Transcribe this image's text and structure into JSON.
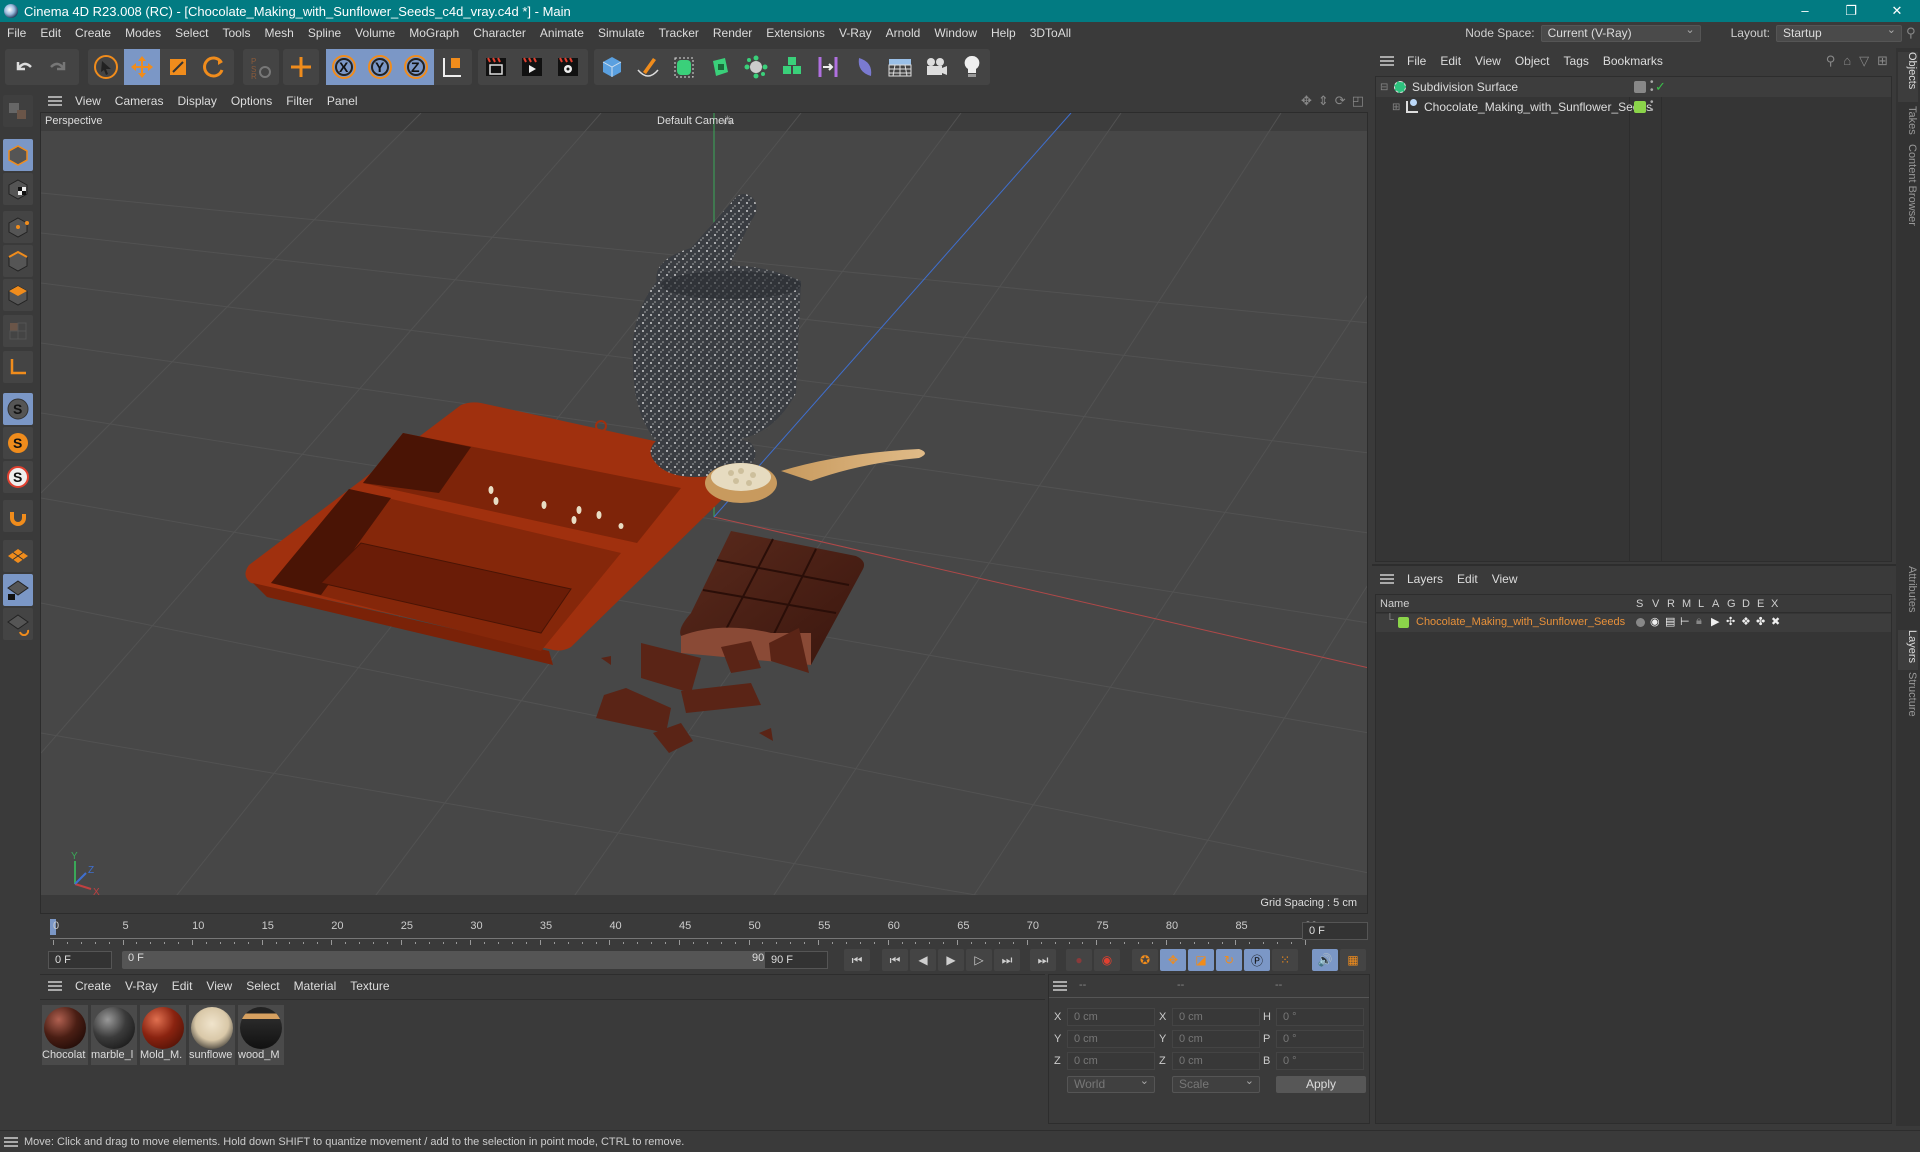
{
  "window": {
    "title": "Cinema 4D R23.008 (RC) - [Chocolate_Making_with_Sunflower_Seeds_c4d_vray.c4d *] - Main",
    "controls": [
      "–",
      "❐",
      "✕"
    ]
  },
  "menubar": {
    "items": [
      "File",
      "Edit",
      "Create",
      "Modes",
      "Select",
      "Tools",
      "Mesh",
      "Spline",
      "Volume",
      "MoGraph",
      "Character",
      "Animate",
      "Simulate",
      "Tracker",
      "Render",
      "Extensions",
      "V-Ray",
      "Arnold",
      "Window",
      "Help",
      "3DToAll"
    ],
    "node_space_label": "Node Space:",
    "node_space_value": "Current (V-Ray)",
    "layout_label": "Layout:",
    "layout_value": "Startup"
  },
  "toolbar": {
    "groups": [
      [
        "undo-icon",
        "redo-icon"
      ],
      [
        "select-icon",
        "move-icon",
        "scale-icon",
        "rotate-icon"
      ],
      [
        "psr-icon"
      ],
      [
        "add-icon"
      ],
      [
        "x-axis-icon",
        "y-axis-icon",
        "z-axis-icon",
        "coordinate-system-icon"
      ],
      [
        "render-view-icon",
        "render-to-picture-viewer-icon",
        "render-settings-icon"
      ],
      [
        "cube-icon",
        "pen-icon",
        "subdivision-icon",
        "extrude-icon",
        "cloner-icon",
        "mograph-icon",
        "symmetry-icon",
        "deformer-icon",
        "floor-icon",
        "camera-icon",
        "light-icon"
      ]
    ]
  },
  "left_tools": [
    "model-mode-icon",
    "object-mode-icon",
    "texture-mode-icon",
    "point-mode-icon",
    "edge-mode-icon",
    "polygon-mode-icon",
    "uv-mode-icon",
    "axis-icon",
    "snap-icon",
    "snap-settings-icon",
    "solo-icon",
    "magnet-icon",
    "workplane-icon",
    "locked-workplane-icon",
    "workplane-align-icon"
  ],
  "viewport": {
    "menu": [
      "View",
      "Cameras",
      "Display",
      "Options",
      "Filter",
      "Panel"
    ],
    "view_name": "Perspective",
    "camera_name": "Default Camera",
    "grid_spacing": "Grid Spacing : 5 cm",
    "axis_labels": {
      "x": "X",
      "y": "Y",
      "z": "Z"
    },
    "scene_objects": [
      "chocolate-mold",
      "mortar-and-pestle",
      "wooden-spoon-with-seeds",
      "chocolate-bar",
      "chocolate-pieces"
    ]
  },
  "timeline": {
    "ticks": [
      "0",
      "5",
      "10",
      "15",
      "20",
      "25",
      "30",
      "35",
      "40",
      "45",
      "50",
      "55",
      "60",
      "65",
      "70",
      "75",
      "80",
      "85",
      "90"
    ],
    "current_frame": "0 F",
    "start_frame": "0 F",
    "range_start": "0 F",
    "range_end": "90 F",
    "end_frame": "90 F",
    "current_frame_right": "0 F"
  },
  "materials": {
    "menu": [
      "Create",
      "V-Ray",
      "Edit",
      "View",
      "Select",
      "Material",
      "Texture"
    ],
    "items": [
      {
        "label": "Chocolat",
        "color": "#4a1e14"
      },
      {
        "label": "marble_l",
        "color": "#3b3b3b"
      },
      {
        "label": "Mold_M.",
        "color": "#8a2310"
      },
      {
        "label": "sunflowe",
        "color": "#d9c8a8"
      },
      {
        "label": "wood_M",
        "color": "#222"
      }
    ]
  },
  "coordinates": {
    "headers": [
      "--",
      "--",
      "--"
    ],
    "rows": [
      {
        "l1": "X",
        "v1": "0 cm",
        "l2": "X",
        "v2": "0 cm",
        "l3": "H",
        "v3": "0 °"
      },
      {
        "l1": "Y",
        "v1": "0 cm",
        "l2": "Y",
        "v2": "0 cm",
        "l3": "P",
        "v3": "0 °"
      },
      {
        "l1": "Z",
        "v1": "0 cm",
        "l2": "Z",
        "v2": "0 cm",
        "l3": "B",
        "v3": "0 °"
      }
    ],
    "space_select": "World",
    "mode_select": "Scale",
    "apply_label": "Apply"
  },
  "objects": {
    "menu": [
      "File",
      "Edit",
      "View",
      "Object",
      "Tags",
      "Bookmarks"
    ],
    "tree": [
      {
        "name": "Subdivision Surface",
        "indent": 0,
        "color": "#2ec27e"
      },
      {
        "name": "Chocolate_Making_with_Sunflower_Seeds",
        "indent": 1,
        "tag_color": "#8bd44a"
      }
    ]
  },
  "layers": {
    "menu": [
      "Layers",
      "Edit",
      "View"
    ],
    "columns": [
      "Name",
      "S",
      "V",
      "R",
      "M",
      "L",
      "A",
      "G",
      "D",
      "E",
      "X"
    ],
    "rows": [
      {
        "name": "Chocolate_Making_with_Sunflower_Seeds",
        "color": "#8bd44a",
        "text_color": "#e8913a"
      }
    ]
  },
  "side_tabs": {
    "top": [
      "Objects",
      "Takes",
      "Content Browser"
    ],
    "bottom": [
      "Attributes",
      "Layers",
      "Structure"
    ]
  },
  "status": {
    "text": "Move: Click and drag to move elements. Hold down SHIFT to quantize movement / add to the selection in point mode, CTRL to remove."
  }
}
